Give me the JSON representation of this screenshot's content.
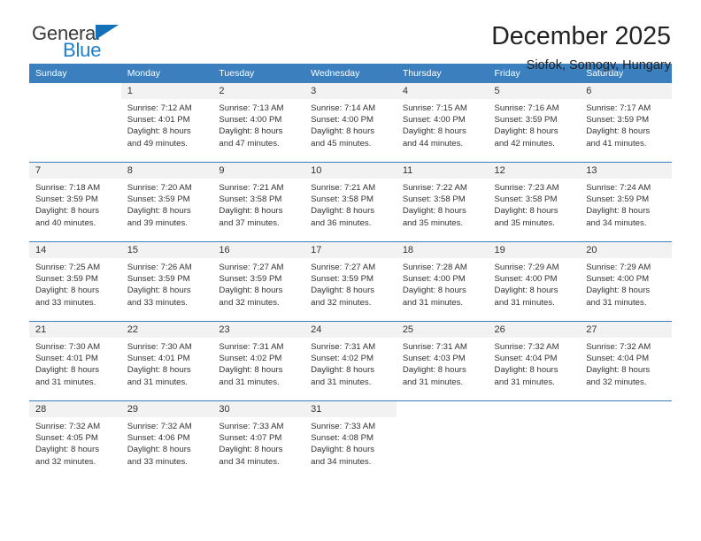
{
  "brand": {
    "line1": "General",
    "line2": "Blue",
    "triangle_color": "#1470b8",
    "blue_color": "#1b7fd0"
  },
  "header": {
    "title": "December 2025",
    "subtitle": "Siofok, Somogy, Hungary"
  },
  "theme": {
    "header_blue": "#3b7fbf",
    "daynum_gray": "#f2f2f2",
    "text": "#333333"
  },
  "weekday_headers": [
    "Sunday",
    "Monday",
    "Tuesday",
    "Wednesday",
    "Thursday",
    "Friday",
    "Saturday"
  ],
  "labels": {
    "sunrise": "Sunrise:",
    "sunset": "Sunset:",
    "daylight": "Daylight:"
  },
  "weeks": [
    [
      {
        "day": "",
        "sunrise": "",
        "sunset": "",
        "daylight1": "",
        "daylight2": "",
        "empty": true
      },
      {
        "day": "1",
        "sunrise": "Sunrise: 7:12 AM",
        "sunset": "Sunset: 4:01 PM",
        "daylight1": "Daylight: 8 hours",
        "daylight2": "and 49 minutes."
      },
      {
        "day": "2",
        "sunrise": "Sunrise: 7:13 AM",
        "sunset": "Sunset: 4:00 PM",
        "daylight1": "Daylight: 8 hours",
        "daylight2": "and 47 minutes."
      },
      {
        "day": "3",
        "sunrise": "Sunrise: 7:14 AM",
        "sunset": "Sunset: 4:00 PM",
        "daylight1": "Daylight: 8 hours",
        "daylight2": "and 45 minutes."
      },
      {
        "day": "4",
        "sunrise": "Sunrise: 7:15 AM",
        "sunset": "Sunset: 4:00 PM",
        "daylight1": "Daylight: 8 hours",
        "daylight2": "and 44 minutes."
      },
      {
        "day": "5",
        "sunrise": "Sunrise: 7:16 AM",
        "sunset": "Sunset: 3:59 PM",
        "daylight1": "Daylight: 8 hours",
        "daylight2": "and 42 minutes."
      },
      {
        "day": "6",
        "sunrise": "Sunrise: 7:17 AM",
        "sunset": "Sunset: 3:59 PM",
        "daylight1": "Daylight: 8 hours",
        "daylight2": "and 41 minutes."
      }
    ],
    [
      {
        "day": "7",
        "sunrise": "Sunrise: 7:18 AM",
        "sunset": "Sunset: 3:59 PM",
        "daylight1": "Daylight: 8 hours",
        "daylight2": "and 40 minutes."
      },
      {
        "day": "8",
        "sunrise": "Sunrise: 7:20 AM",
        "sunset": "Sunset: 3:59 PM",
        "daylight1": "Daylight: 8 hours",
        "daylight2": "and 39 minutes."
      },
      {
        "day": "9",
        "sunrise": "Sunrise: 7:21 AM",
        "sunset": "Sunset: 3:58 PM",
        "daylight1": "Daylight: 8 hours",
        "daylight2": "and 37 minutes."
      },
      {
        "day": "10",
        "sunrise": "Sunrise: 7:21 AM",
        "sunset": "Sunset: 3:58 PM",
        "daylight1": "Daylight: 8 hours",
        "daylight2": "and 36 minutes."
      },
      {
        "day": "11",
        "sunrise": "Sunrise: 7:22 AM",
        "sunset": "Sunset: 3:58 PM",
        "daylight1": "Daylight: 8 hours",
        "daylight2": "and 35 minutes."
      },
      {
        "day": "12",
        "sunrise": "Sunrise: 7:23 AM",
        "sunset": "Sunset: 3:58 PM",
        "daylight1": "Daylight: 8 hours",
        "daylight2": "and 35 minutes."
      },
      {
        "day": "13",
        "sunrise": "Sunrise: 7:24 AM",
        "sunset": "Sunset: 3:59 PM",
        "daylight1": "Daylight: 8 hours",
        "daylight2": "and 34 minutes."
      }
    ],
    [
      {
        "day": "14",
        "sunrise": "Sunrise: 7:25 AM",
        "sunset": "Sunset: 3:59 PM",
        "daylight1": "Daylight: 8 hours",
        "daylight2": "and 33 minutes."
      },
      {
        "day": "15",
        "sunrise": "Sunrise: 7:26 AM",
        "sunset": "Sunset: 3:59 PM",
        "daylight1": "Daylight: 8 hours",
        "daylight2": "and 33 minutes."
      },
      {
        "day": "16",
        "sunrise": "Sunrise: 7:27 AM",
        "sunset": "Sunset: 3:59 PM",
        "daylight1": "Daylight: 8 hours",
        "daylight2": "and 32 minutes."
      },
      {
        "day": "17",
        "sunrise": "Sunrise: 7:27 AM",
        "sunset": "Sunset: 3:59 PM",
        "daylight1": "Daylight: 8 hours",
        "daylight2": "and 32 minutes."
      },
      {
        "day": "18",
        "sunrise": "Sunrise: 7:28 AM",
        "sunset": "Sunset: 4:00 PM",
        "daylight1": "Daylight: 8 hours",
        "daylight2": "and 31 minutes."
      },
      {
        "day": "19",
        "sunrise": "Sunrise: 7:29 AM",
        "sunset": "Sunset: 4:00 PM",
        "daylight1": "Daylight: 8 hours",
        "daylight2": "and 31 minutes."
      },
      {
        "day": "20",
        "sunrise": "Sunrise: 7:29 AM",
        "sunset": "Sunset: 4:00 PM",
        "daylight1": "Daylight: 8 hours",
        "daylight2": "and 31 minutes."
      }
    ],
    [
      {
        "day": "21",
        "sunrise": "Sunrise: 7:30 AM",
        "sunset": "Sunset: 4:01 PM",
        "daylight1": "Daylight: 8 hours",
        "daylight2": "and 31 minutes."
      },
      {
        "day": "22",
        "sunrise": "Sunrise: 7:30 AM",
        "sunset": "Sunset: 4:01 PM",
        "daylight1": "Daylight: 8 hours",
        "daylight2": "and 31 minutes."
      },
      {
        "day": "23",
        "sunrise": "Sunrise: 7:31 AM",
        "sunset": "Sunset: 4:02 PM",
        "daylight1": "Daylight: 8 hours",
        "daylight2": "and 31 minutes."
      },
      {
        "day": "24",
        "sunrise": "Sunrise: 7:31 AM",
        "sunset": "Sunset: 4:02 PM",
        "daylight1": "Daylight: 8 hours",
        "daylight2": "and 31 minutes."
      },
      {
        "day": "25",
        "sunrise": "Sunrise: 7:31 AM",
        "sunset": "Sunset: 4:03 PM",
        "daylight1": "Daylight: 8 hours",
        "daylight2": "and 31 minutes."
      },
      {
        "day": "26",
        "sunrise": "Sunrise: 7:32 AM",
        "sunset": "Sunset: 4:04 PM",
        "daylight1": "Daylight: 8 hours",
        "daylight2": "and 31 minutes."
      },
      {
        "day": "27",
        "sunrise": "Sunrise: 7:32 AM",
        "sunset": "Sunset: 4:04 PM",
        "daylight1": "Daylight: 8 hours",
        "daylight2": "and 32 minutes."
      }
    ],
    [
      {
        "day": "28",
        "sunrise": "Sunrise: 7:32 AM",
        "sunset": "Sunset: 4:05 PM",
        "daylight1": "Daylight: 8 hours",
        "daylight2": "and 32 minutes."
      },
      {
        "day": "29",
        "sunrise": "Sunrise: 7:32 AM",
        "sunset": "Sunset: 4:06 PM",
        "daylight1": "Daylight: 8 hours",
        "daylight2": "and 33 minutes."
      },
      {
        "day": "30",
        "sunrise": "Sunrise: 7:33 AM",
        "sunset": "Sunset: 4:07 PM",
        "daylight1": "Daylight: 8 hours",
        "daylight2": "and 34 minutes."
      },
      {
        "day": "31",
        "sunrise": "Sunrise: 7:33 AM",
        "sunset": "Sunset: 4:08 PM",
        "daylight1": "Daylight: 8 hours",
        "daylight2": "and 34 minutes."
      },
      {
        "day": "",
        "sunrise": "",
        "sunset": "",
        "daylight1": "",
        "daylight2": "",
        "empty": true
      },
      {
        "day": "",
        "sunrise": "",
        "sunset": "",
        "daylight1": "",
        "daylight2": "",
        "empty": true
      },
      {
        "day": "",
        "sunrise": "",
        "sunset": "",
        "daylight1": "",
        "daylight2": "",
        "empty": true
      }
    ]
  ]
}
